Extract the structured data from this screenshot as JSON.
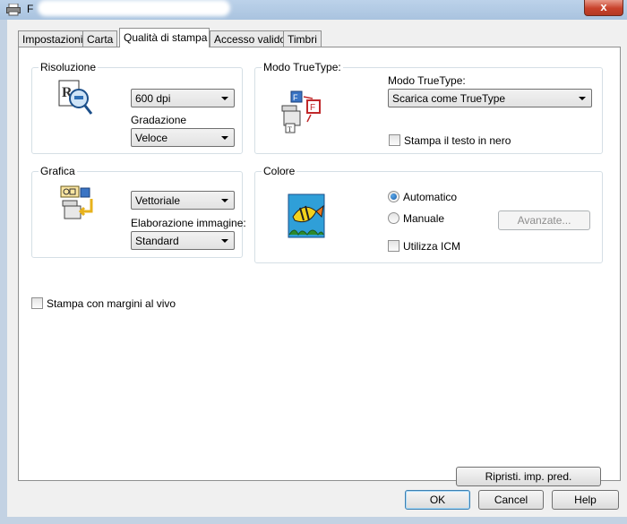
{
  "window": {
    "title": "F",
    "close_label": "x"
  },
  "tabs": [
    {
      "label": "Impostazioni"
    },
    {
      "label": "Carta"
    },
    {
      "label": "Qualità di stampa"
    },
    {
      "label": "Accesso valido"
    },
    {
      "label": "Timbri"
    }
  ],
  "risoluzione": {
    "title": "Risoluzione",
    "resolution_value": "600 dpi",
    "gradazione_label": "Gradazione",
    "gradazione_value": "Veloce"
  },
  "truetype": {
    "title": "Modo TrueType:",
    "mode_label": "Modo TrueType:",
    "mode_value": "Scarica come TrueType",
    "black_text_label": "Stampa il testo in nero",
    "black_text_checked": false
  },
  "grafica": {
    "title": "Grafica",
    "graphics_value": "Vettoriale",
    "elaborazione_label": "Elaborazione immagine:",
    "elaborazione_value": "Standard"
  },
  "colore": {
    "title": "Colore",
    "auto_label": "Automatico",
    "manual_label": "Manuale",
    "advanced_label": "Avanzate...",
    "icm_label": "Utilizza ICM",
    "selected": "auto",
    "icm_checked": false
  },
  "bleed": {
    "label": "Stampa con margini al vivo",
    "checked": false
  },
  "restore_label": "Ripristi. imp. pred.",
  "footer": {
    "ok": "OK",
    "cancel": "Cancel",
    "help": "Help"
  }
}
